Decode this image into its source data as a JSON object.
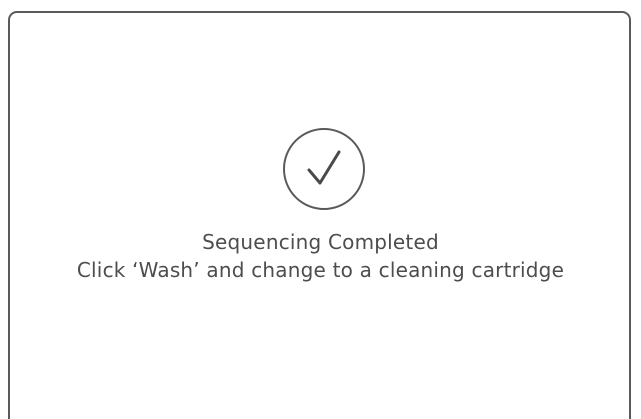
{
  "dialog": {
    "title": "Sequencing Completed",
    "message": "Click ‘Wash’ and change to a cleaning cartridge",
    "status_icon": "checkmark-circle-icon"
  },
  "colors": {
    "border": "#5a5a5a",
    "text": "#4d4d4d",
    "background": "#ffffff"
  }
}
